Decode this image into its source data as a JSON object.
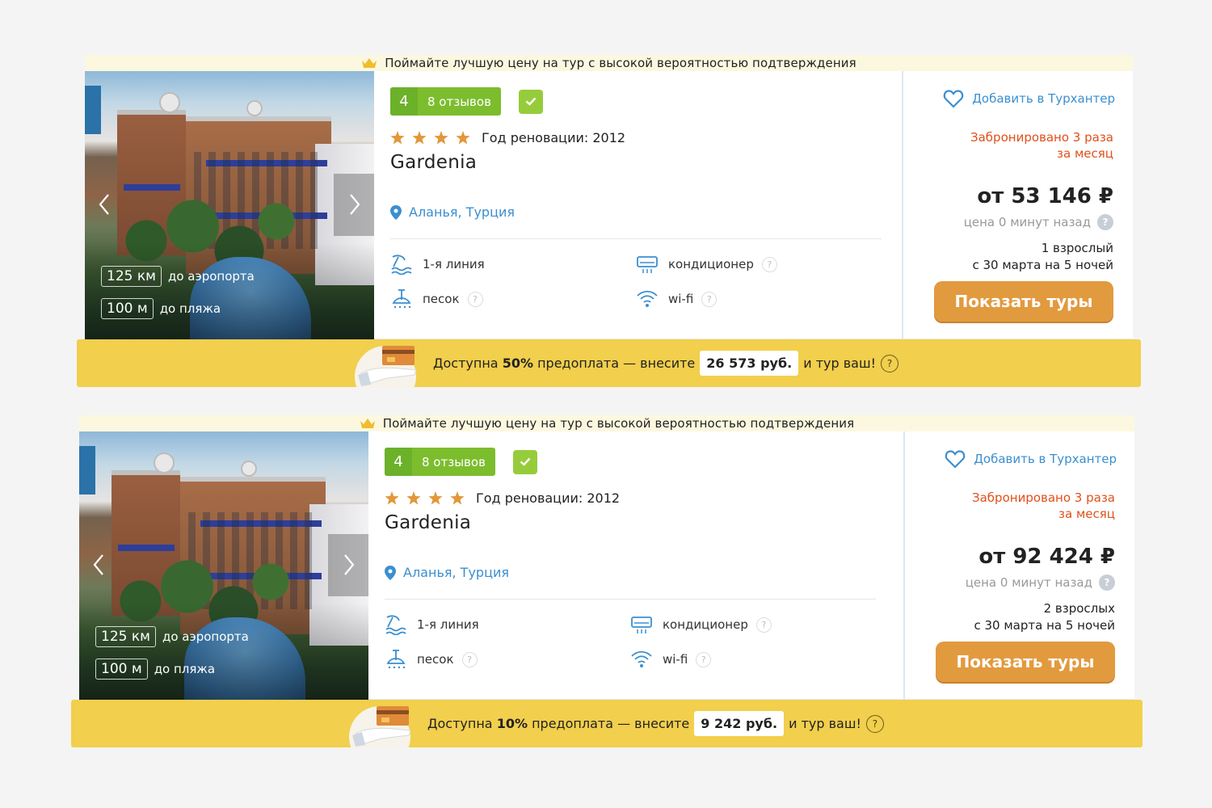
{
  "cards": [
    {
      "promo": "Поймайте лучшую цену на тур с высокой вероятностью подтверждения",
      "rating": "4",
      "reviews": "8 отзывов",
      "renovation": "Год реновации: 2012",
      "stars": 4,
      "name": "Gardenia",
      "location": "Аланья, Турция",
      "airport_distance": "125 км",
      "airport_label": "до аэропорта",
      "beach_distance": "100 м",
      "beach_label": "до пляжа",
      "features": {
        "line": "1-я линия",
        "ac": "кондиционер",
        "sand": "песок",
        "wifi": "wi-fi"
      },
      "favorite": "Добавить в Турхантер",
      "booked_line1": "Забронировано 3 раза",
      "booked_line2": "за месяц",
      "price": "от 53 146 ₽",
      "price_age": "цена 0 минут назад",
      "pax": "1 взрослый",
      "dates": "с 30 марта на 5 ночей",
      "button": "Показать туры",
      "prepay_prefix": "Доступна ",
      "prepay_percent": "50%",
      "prepay_middle": " предоплата — внесите",
      "prepay_amount": "26 573 руб.",
      "prepay_suffix": "и тур ваш!"
    },
    {
      "promo": "Поймайте лучшую цену на тур с высокой вероятностью подтверждения",
      "rating": "4",
      "reviews": "8 отзывов",
      "renovation": "Год реновации: 2012",
      "stars": 4,
      "name": "Gardenia",
      "location": "Аланья, Турция",
      "airport_distance": "125 км",
      "airport_label": "до аэропорта",
      "beach_distance": "100 м",
      "beach_label": "до пляжа",
      "features": {
        "line": "1-я линия",
        "ac": "кондиционер",
        "sand": "песок",
        "wifi": "wi-fi"
      },
      "favorite": "Добавить в Турхантер",
      "booked_line1": "Забронировано 3 раза",
      "booked_line2": "за месяц",
      "price": "от 92 424 ₽",
      "price_age": "цена 0 минут назад",
      "pax": "2 взрослых",
      "dates": "с 30 марта на 5 ночей",
      "button": "Показать туры",
      "prepay_prefix": "Доступна ",
      "prepay_percent": "10%",
      "prepay_middle": " предоплата — внесите",
      "prepay_amount": "9 242 руб.",
      "prepay_suffix": "и тур ваш!"
    }
  ],
  "colors": {
    "accent_blue": "#3b8fd0",
    "rating_green": "#7cbd2e",
    "booked_red": "#e0501a",
    "button_orange": "#e29a3e",
    "prepay_yellow": "#f2cf4c",
    "star_orange": "#e4973a"
  },
  "icons": [
    "crown-icon",
    "check-icon",
    "star-icon",
    "location-pin-icon",
    "beach-line-icon",
    "sand-icon",
    "air-conditioner-icon",
    "wifi-icon",
    "heart-icon",
    "question-icon",
    "prepay-card-hand-icon",
    "chevron-left-icon",
    "chevron-right-icon"
  ]
}
